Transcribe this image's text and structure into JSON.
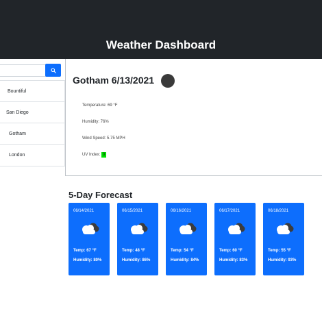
{
  "header": {
    "title": "Weather Dashboard"
  },
  "sidebar": {
    "search": {
      "placeholder": "",
      "value": "",
      "button_icon": "search-icon"
    },
    "cities": [
      "Bountiful",
      "San Diego",
      "Gotham",
      "London"
    ]
  },
  "current": {
    "title": "Gotham 6/13/2021",
    "icon": "moon-icon",
    "temperature": "Temperature: 69 °F",
    "humidity": "Humidity: 76%",
    "wind": "Wind Speed: 5.75 MPH",
    "uv_label": "UV Index:",
    "uv_value": "0",
    "uv_color": "#00e000"
  },
  "forecast": {
    "title": "5-Day Forecast",
    "days": [
      {
        "date": "06/14/2021",
        "icon": "cloud-icon",
        "temp": "Temp: 67 °F",
        "humidity": "Humidity: 80%"
      },
      {
        "date": "06/15/2021",
        "icon": "cloud-icon",
        "temp": "Temp: 48 °F",
        "humidity": "Humidity: 86%"
      },
      {
        "date": "06/16/2021",
        "icon": "cloud-icon",
        "temp": "Temp: 54 °F",
        "humidity": "Humidity: 84%"
      },
      {
        "date": "06/17/2021",
        "icon": "cloud-icon",
        "temp": "Temp: 60 °F",
        "humidity": "Humidity: 83%"
      },
      {
        "date": "06/18/2021",
        "icon": "cloud-icon",
        "temp": "Temp: 55 °F",
        "humidity": "Humidity: 93%"
      }
    ]
  },
  "colors": {
    "header_bg": "#212529",
    "accent": "#0d6efd"
  }
}
